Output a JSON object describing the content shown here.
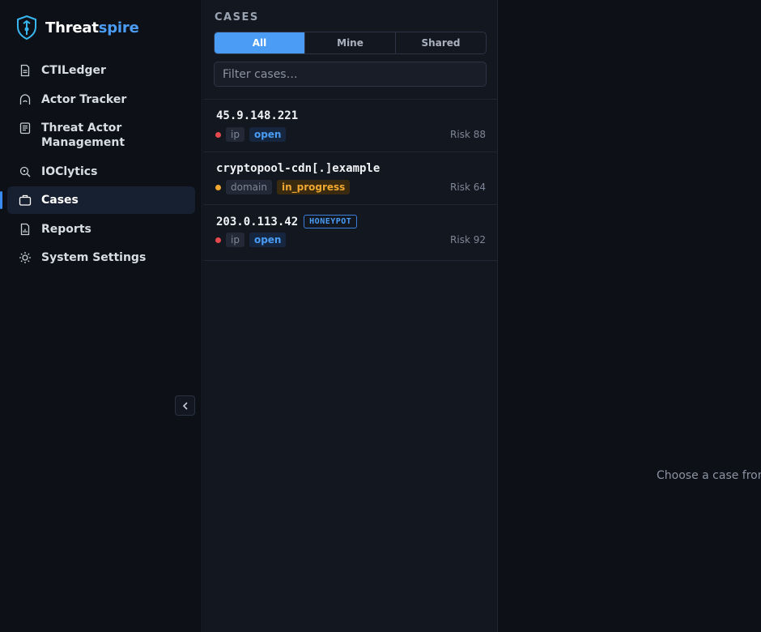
{
  "brand": {
    "name_part1": "Threat",
    "name_part2": "spire",
    "color_primary": "#ffffff",
    "color_accent": "#4a9cf5"
  },
  "sidebar": {
    "items": [
      {
        "label": "CTILedger",
        "icon": "document-icon",
        "active": false
      },
      {
        "label": "Actor Tracker",
        "icon": "hood-icon",
        "active": false
      },
      {
        "label": "Threat Actor\nManagement",
        "icon": "list-document-icon",
        "active": false
      },
      {
        "label": "IOClytics",
        "icon": "magnifier-icon",
        "active": false
      },
      {
        "label": "Cases",
        "icon": "briefcase-icon",
        "active": true
      },
      {
        "label": "Reports",
        "icon": "bar-chart-icon",
        "active": false
      },
      {
        "label": "System Settings",
        "icon": "gear-icon",
        "active": false
      }
    ]
  },
  "cases_panel": {
    "title": "CASES",
    "tabs": [
      {
        "label": "All",
        "active": true
      },
      {
        "label": "Mine",
        "active": false
      },
      {
        "label": "Shared",
        "active": false
      }
    ],
    "filter_placeholder": "Filter cases…",
    "rows": [
      {
        "name": "45.9.148.221",
        "type": "ip",
        "status": "open",
        "risk": "Risk 88",
        "dot_color": "#e5484d",
        "badge": ""
      },
      {
        "name": "cryptopool-cdn[.]example",
        "type": "domain",
        "status": "in_progress",
        "risk": "Risk 64",
        "dot_color": "#f0a830",
        "badge": ""
      },
      {
        "name": "203.0.113.42",
        "type": "ip",
        "status": "open",
        "risk": "Risk 92",
        "dot_color": "#e5484d",
        "badge": "HONEYPOT"
      }
    ]
  },
  "detail": {
    "empty_message": "Choose a case from the list"
  }
}
